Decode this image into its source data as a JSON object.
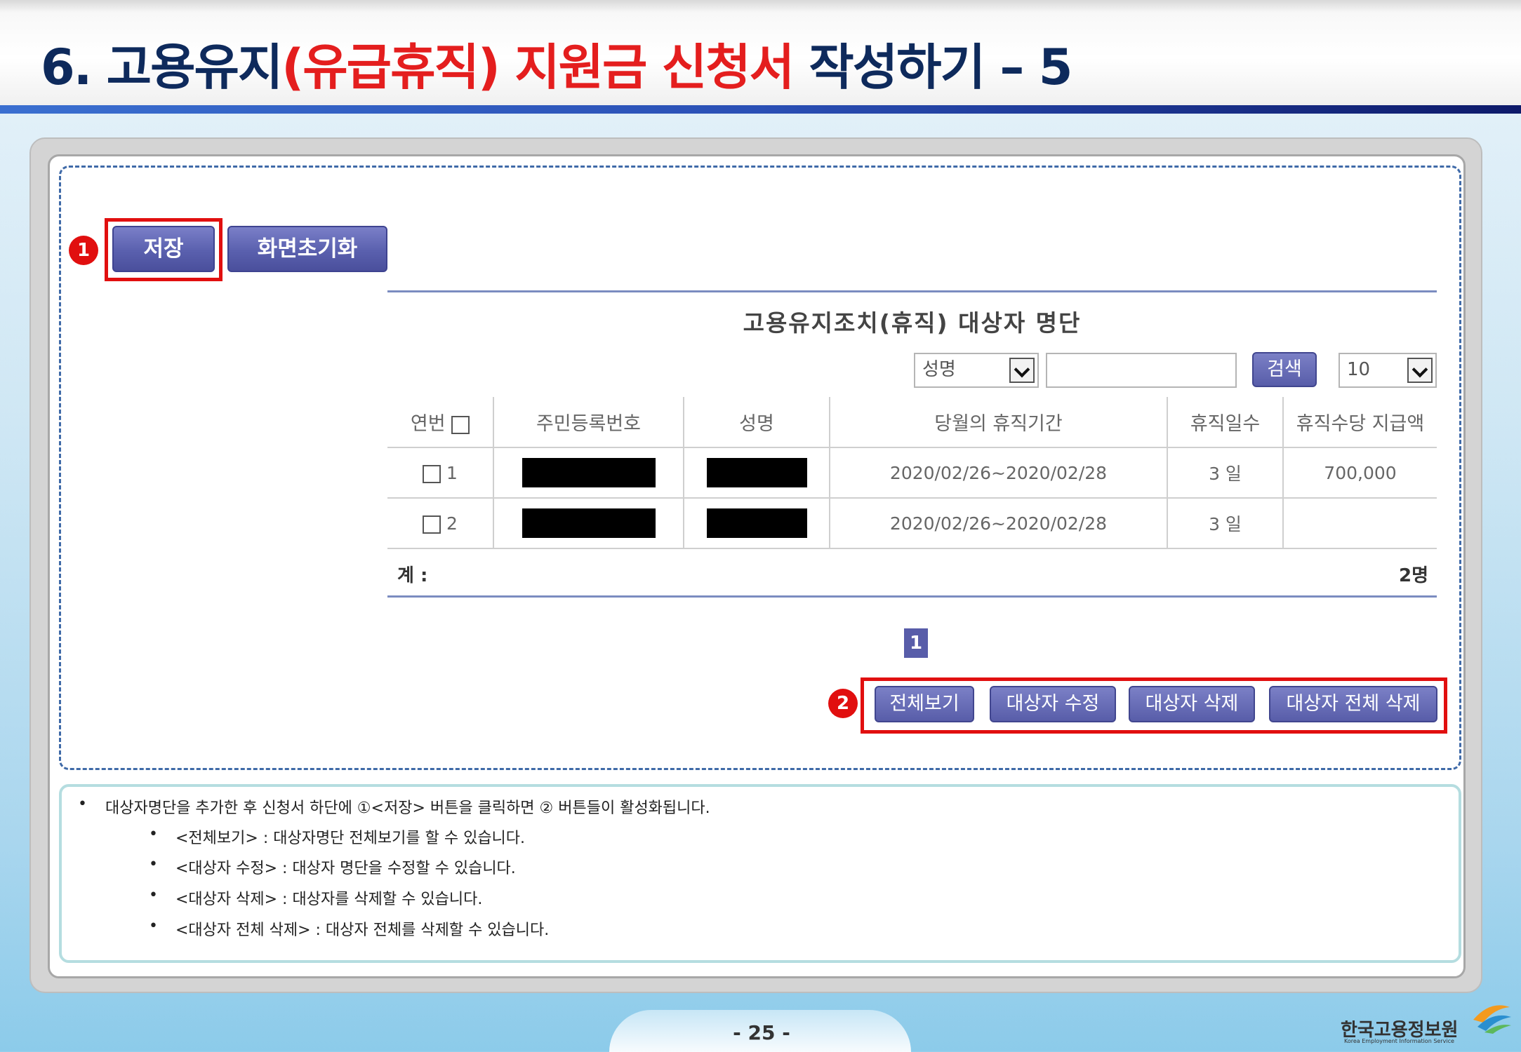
{
  "slide": {
    "title_pre": "6. 고용유지",
    "title_hl": "(유급휴직) 지원금 신청서",
    "title_post": " 작성하기 – 5",
    "page_number": "- 25 -"
  },
  "toolbar": {
    "save_label": "저장",
    "reset_label": "화면초기화"
  },
  "markers": {
    "one": "1",
    "two": "2"
  },
  "list": {
    "title": "고용유지조치(휴직) 대상자 명단",
    "search_field": "성명",
    "search_value": "",
    "search_button": "검색",
    "page_size": "10",
    "columns": [
      "연번",
      "주민등록번호",
      "성명",
      "당월의 휴직기간",
      "휴직일수",
      "휴직수당 지급액"
    ],
    "rows": [
      {
        "no": "1",
        "period": "2020/02/26~2020/02/28",
        "days": "3 일",
        "amount": "700,000"
      },
      {
        "no": "2",
        "period": "2020/02/26~2020/02/28",
        "days": "3 일",
        "amount": ""
      }
    ],
    "total_label": "계 :",
    "total_value": "2명",
    "pagination": [
      "1"
    ]
  },
  "actions": {
    "view_all": "전체보기",
    "edit": "대상자 수정",
    "delete": "대상자 삭제",
    "delete_all": "대상자 전체 삭제"
  },
  "notes": {
    "main": "대상자명단을 추가한 후 신청서 하단에 ①<저장> 버튼을 클릭하면 ② 버튼들이 활성화됩니다.",
    "items": [
      "<전체보기> : 대상자명단 전체보기를 할 수 있습니다.",
      "<대상자 수정> : 대상자 명단을 수정할 수 있습니다.",
      "<대상자 삭제> : 대상자를 삭제할 수 있습니다.",
      "<대상자 전체 삭제> : 대상자 전체를 삭제할 수 있습니다."
    ],
    "bullet": "•"
  },
  "logo": {
    "name": "한국고용정보원",
    "sub": "Korea Employment Information Service"
  },
  "colors": {
    "title_navy": "#0e2a5c",
    "title_red": "#e41e1e",
    "button_purple": "#585da9",
    "highlight_red": "#e10f0f"
  }
}
